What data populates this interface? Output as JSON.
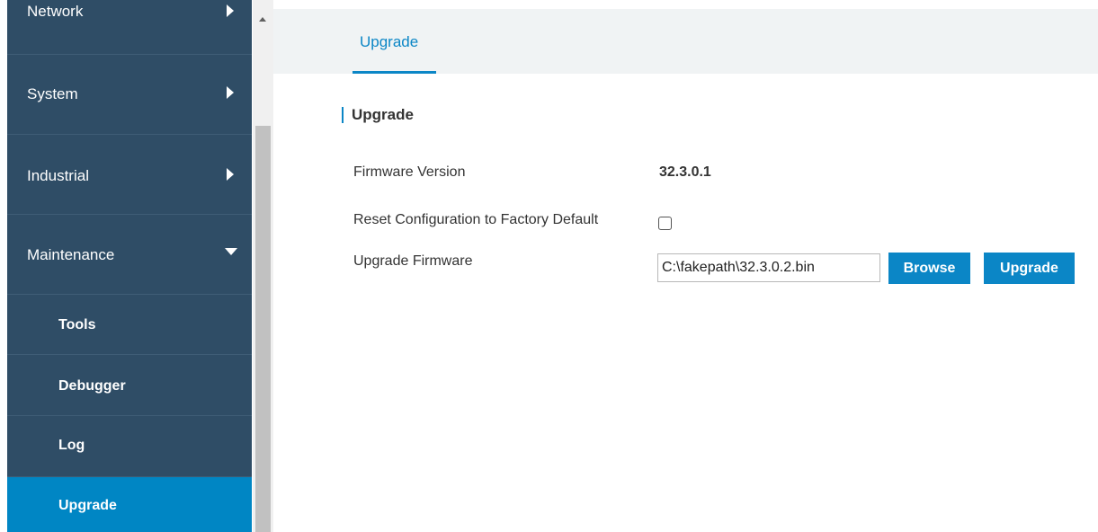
{
  "sidebar": {
    "items": [
      {
        "label": "Network"
      },
      {
        "label": "System"
      },
      {
        "label": "Industrial"
      },
      {
        "label": "Maintenance"
      }
    ],
    "subitems": [
      {
        "label": "Tools"
      },
      {
        "label": "Debugger"
      },
      {
        "label": "Log"
      },
      {
        "label": "Upgrade"
      }
    ]
  },
  "tabs": [
    {
      "label": "Upgrade"
    }
  ],
  "section": {
    "title": "Upgrade"
  },
  "form": {
    "firmware_version_label": "Firmware Version",
    "firmware_version_value": "32.3.0.1",
    "reset_label": "Reset Configuration to Factory Default",
    "upgrade_firmware_label": "Upgrade Firmware",
    "file_value": "C:\\fakepath\\32.3.0.2.bin",
    "browse_label": "Browse",
    "upgrade_button_label": "Upgrade"
  },
  "colors": {
    "sidebar_bg": "#2f4d66",
    "accent": "#0b86c6",
    "active_item": "#0086c4"
  }
}
